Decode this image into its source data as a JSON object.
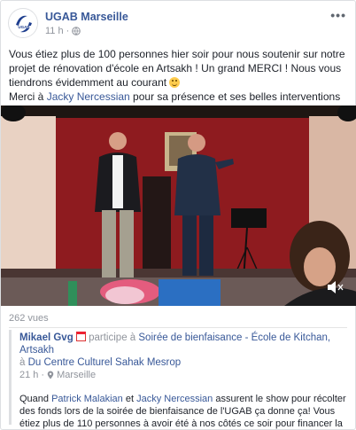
{
  "post": {
    "page_name": "UGAB Marseille",
    "time": "11 h",
    "privacy_separator": "·",
    "more_label": "•••",
    "text": {
      "line1": "Vous étiez plus de 100 personnes hier soir pour nous soutenir sur notre projet de rénovation d'école en Artsakh ! Un grand MERCI ! Nous vous tiendrons évidemment au courant",
      "line2_pre": "Merci à ",
      "line2_link": "Jacky Nercessian",
      "line2_post": " pour sa présence et ses belles interventions"
    },
    "views": "262 vues"
  },
  "shared": {
    "author": "Mikael Gvg",
    "participates": " participe à ",
    "event": "Soirée de bienfaisance - École de Kitchan, Artsakh",
    "at": "à ",
    "venue": "Du Centre Culturel Sahak Mesrop",
    "time": "21 h",
    "dot": "·",
    "location": "Marseille",
    "text": {
      "p1": "Quand ",
      "n1": "Patrick Malakian",
      "p2": " et ",
      "n2": "Jacky Nercessian",
      "p3": " assurent le show pour récolter des fonds lors de la soirée de bienfaisance de l'UGAB ça donne ça! Vous étiez plus de 110 personnes à avoir été à nos côtés ce soir pour financer la rénovation de l'école primaire de Kitchan - Artsakh! Merci beaucoup!"
    }
  },
  "colors": {
    "link": "#385898",
    "muted": "#90949c",
    "stage_wall": "#8e1b1f"
  }
}
